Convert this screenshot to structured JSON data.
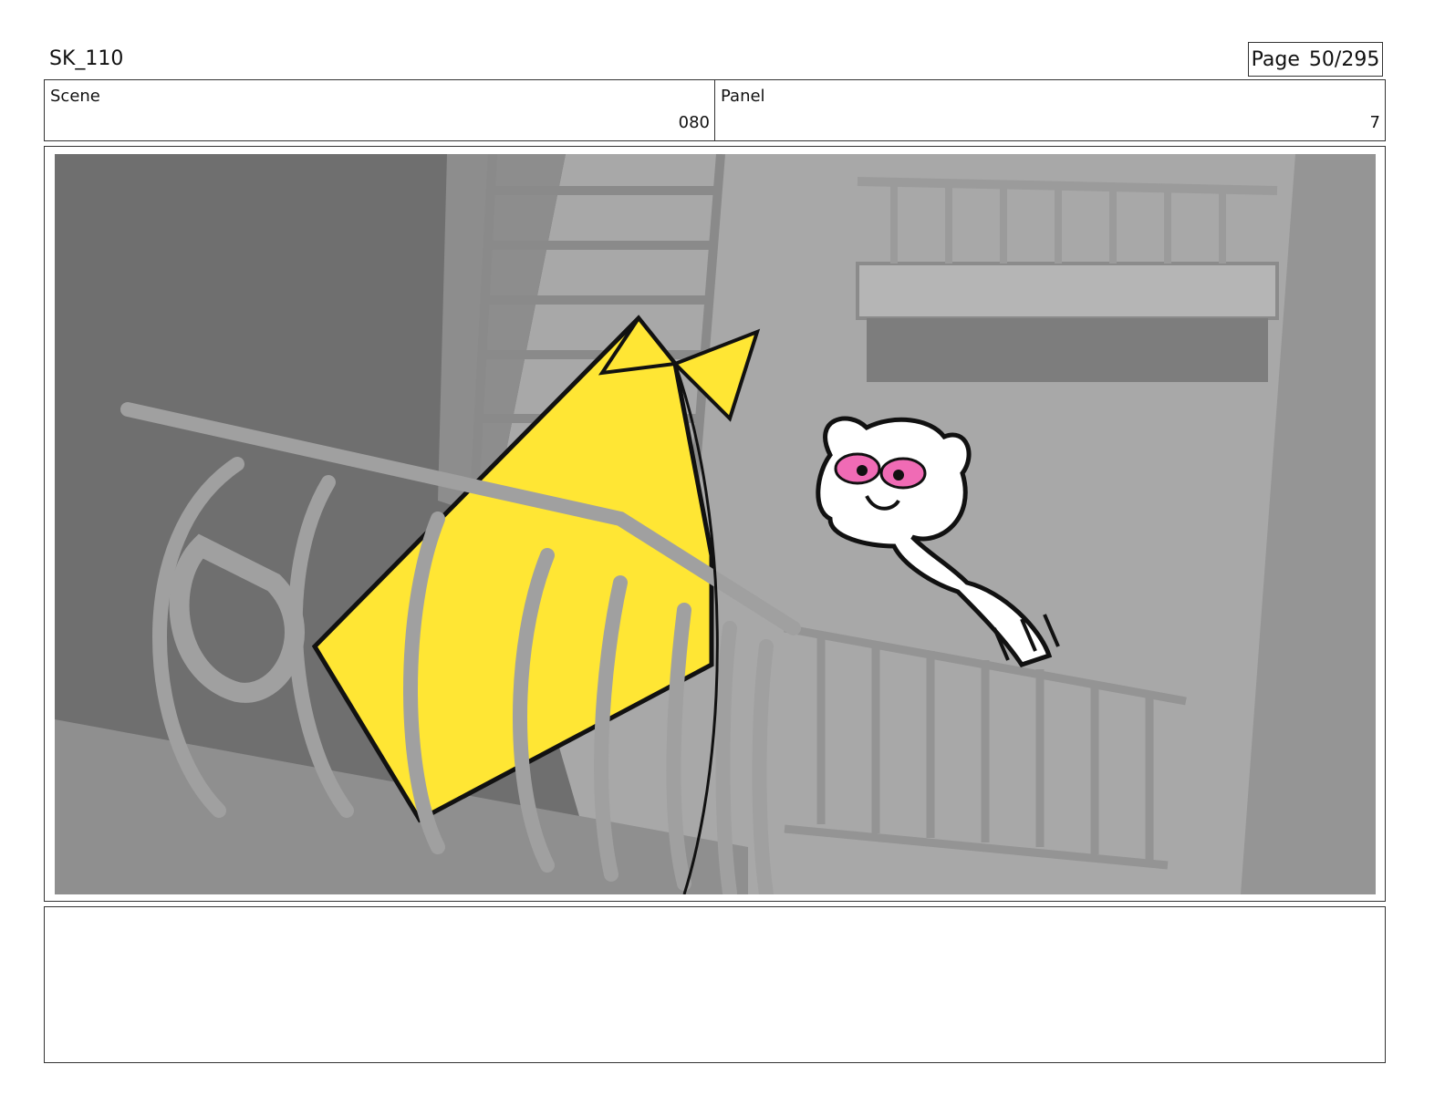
{
  "sheet": {
    "title": "SK_110",
    "page_label": "Page",
    "page_number": "50/295"
  },
  "header": {
    "scene_label": "Scene",
    "scene_value": "080",
    "panel_label": "Panel",
    "panel_value": "7"
  },
  "artwork": {
    "description_icon": "storyboard-frame-illustration",
    "colors": {
      "background_dark": "#6e6e6e",
      "wall": "#a7a7a7",
      "railing": "#9a9a9a",
      "flag": "#ffe634",
      "character_mask": "#f06bb5"
    }
  },
  "notes": {
    "text": ""
  }
}
